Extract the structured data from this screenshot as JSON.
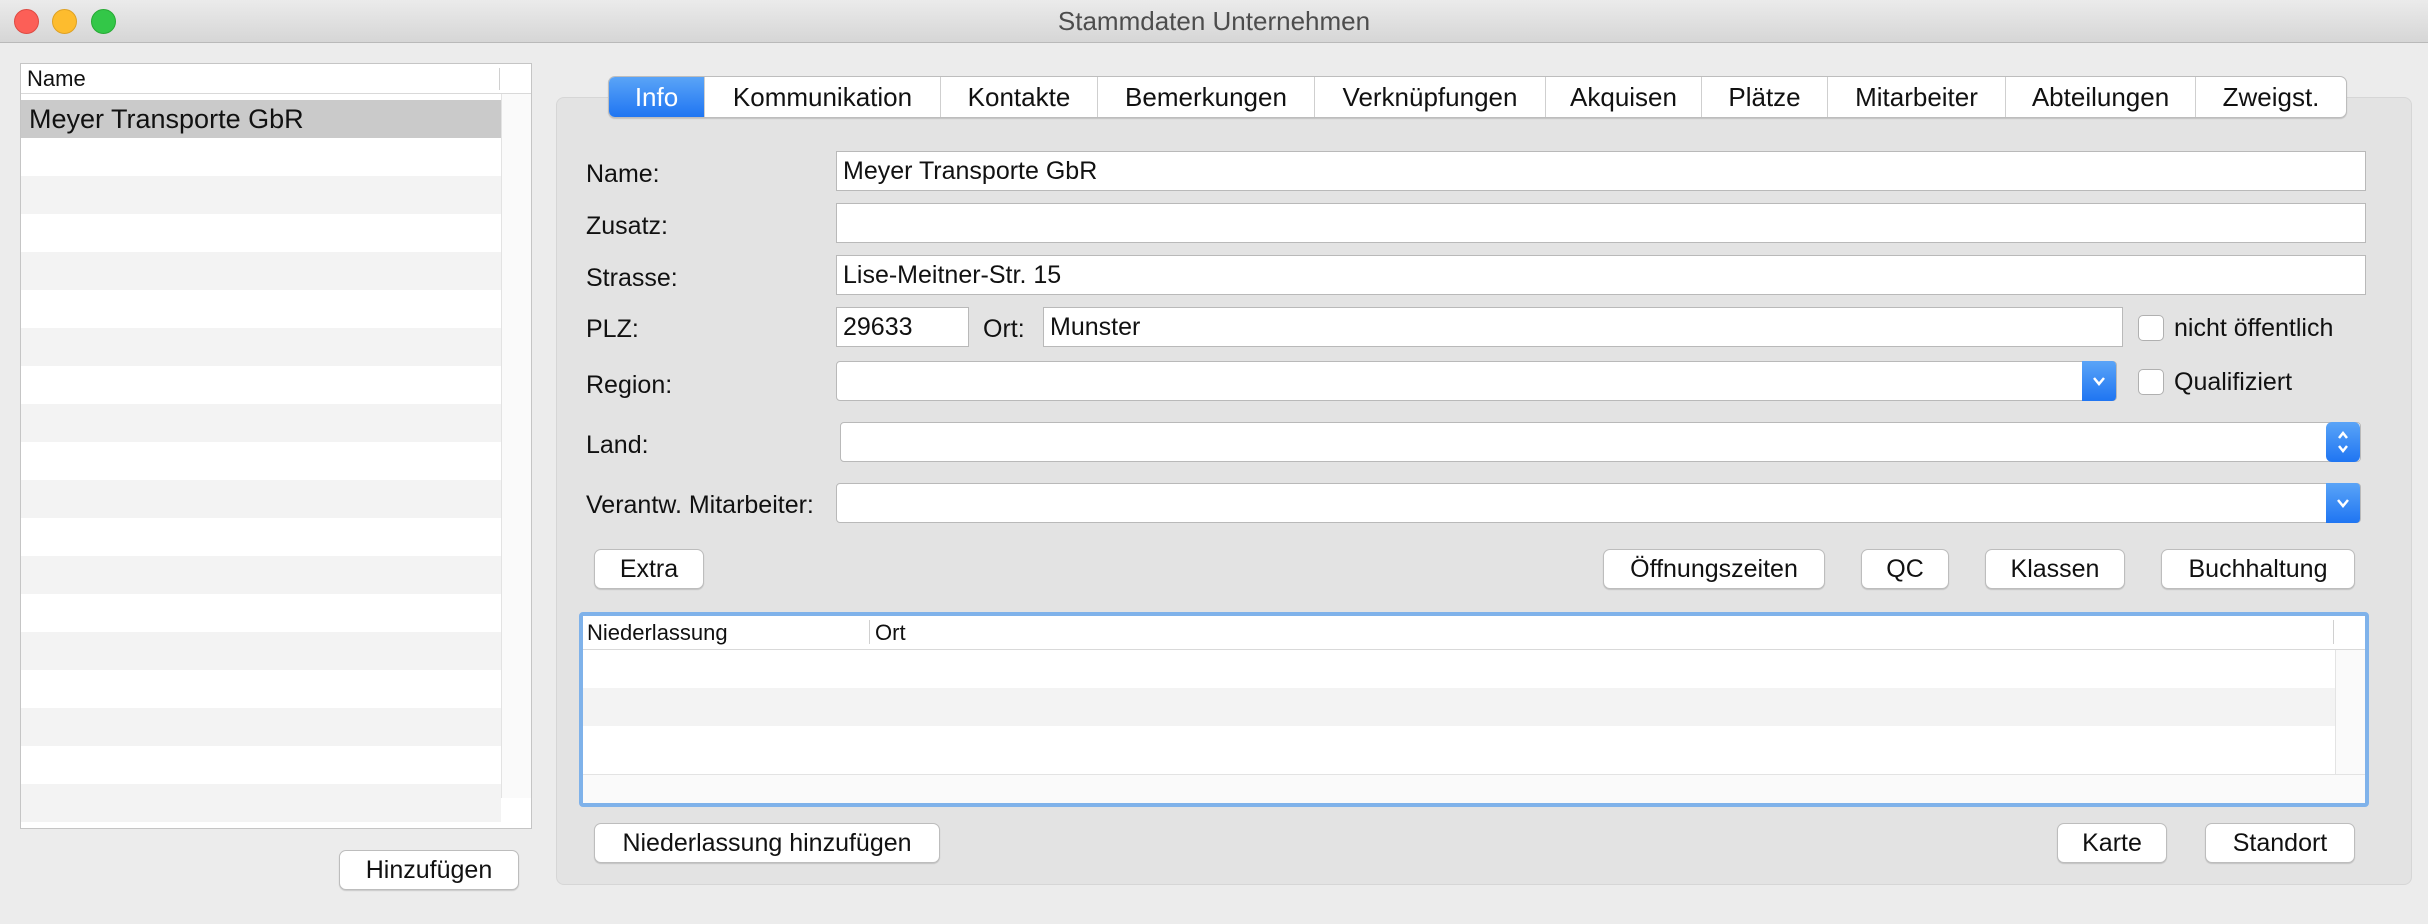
{
  "window": {
    "title": "Stammdaten Unternehmen"
  },
  "left_list": {
    "column_header": "Name",
    "rows": [
      "Meyer Transporte GbR"
    ],
    "add_button": "Hinzufügen"
  },
  "tabs": [
    "Info",
    "Kommunikation",
    "Kontakte",
    "Bemerkungen",
    "Verknüpfungen",
    "Akquisen",
    "Plätze",
    "Mitarbeiter",
    "Abteilungen",
    "Zweigst."
  ],
  "active_tab": "Info",
  "form": {
    "name_label": "Name:",
    "name_value": "Meyer Transporte GbR",
    "zusatz_label": "Zusatz:",
    "zusatz_value": "",
    "strasse_label": "Strasse:",
    "strasse_value": "Lise-Meitner-Str. 15",
    "plz_label": "PLZ:",
    "plz_value": "29633",
    "ort_label": "Ort:",
    "ort_value": "Munster",
    "nicht_oeffentlich_label": "nicht öffentlich",
    "nicht_oeffentlich_checked": false,
    "region_label": "Region:",
    "region_value": "",
    "qualifiziert_label": "Qualifiziert",
    "qualifiziert_checked": false,
    "land_label": "Land:",
    "land_value": "",
    "mitarbeiter_label": "Verantw. Mitarbeiter:",
    "mitarbeiter_value": ""
  },
  "buttons": {
    "extra": "Extra",
    "oeffnungszeiten": "Öffnungszeiten",
    "qc": "QC",
    "klassen": "Klassen",
    "buchhaltung": "Buchhaltung",
    "niederlassung_hinzufuegen": "Niederlassung hinzufügen",
    "karte": "Karte",
    "standort": "Standort"
  },
  "niederlassung_table": {
    "columns": [
      "Niederlassung",
      "Ort"
    ],
    "rows": []
  },
  "colors": {
    "accent": "#1f75f2",
    "focus_ring": "#7fb2ea",
    "selection": "#cacaca"
  },
  "icons": {
    "combo_arrow": "chevron-down-icon",
    "stepper": "up-down-chevron-icon"
  }
}
